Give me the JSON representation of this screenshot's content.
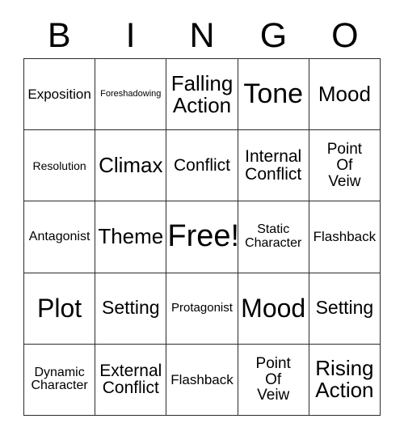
{
  "card": {
    "header_letters": [
      "B",
      "I",
      "N",
      "G",
      "O"
    ],
    "grid": {
      "rows": 5,
      "columns": 5,
      "cells": [
        {
          "text": "Exposition",
          "size": "fs-m"
        },
        {
          "text": "Foreshadowing",
          "size": "fs-xxs"
        },
        {
          "text": "Falling\nAction",
          "size": "fs-xxl"
        },
        {
          "text": "Tone",
          "size": "fs-h3"
        },
        {
          "text": "Mood",
          "size": "fs-xxl"
        },
        {
          "text": "Resolution",
          "size": "fs-xs"
        },
        {
          "text": "Climax",
          "size": "fs-xxl"
        },
        {
          "text": "Conflict",
          "size": "fs-l"
        },
        {
          "text": "Internal\nConflict",
          "size": "fs-l"
        },
        {
          "text": "Point\nOf\nVeiw",
          "size": "fs-ml"
        },
        {
          "text": "Antagonist",
          "size": "fs-sm"
        },
        {
          "text": "Theme",
          "size": "fs-xxl"
        },
        {
          "text": "Free!",
          "size": "fs-free"
        },
        {
          "text": "Static\nCharacter",
          "size": "fs-sm"
        },
        {
          "text": "Flashback",
          "size": "fs-m"
        },
        {
          "text": "Plot",
          "size": "fs-h2"
        },
        {
          "text": "Setting",
          "size": "fs-xl"
        },
        {
          "text": "Protagonist",
          "size": "fs-s"
        },
        {
          "text": "Mood",
          "size": "fs-h2"
        },
        {
          "text": "Setting",
          "size": "fs-xl"
        },
        {
          "text": "Dynamic\nCharacter",
          "size": "fs-sm"
        },
        {
          "text": "External\nConflict",
          "size": "fs-l"
        },
        {
          "text": "Flashback",
          "size": "fs-m"
        },
        {
          "text": "Point\nOf\nVeiw",
          "size": "fs-ml"
        },
        {
          "text": "Rising\nAction",
          "size": "fs-xxl"
        }
      ]
    },
    "colors": {
      "background": "#ffffff",
      "text": "#000000",
      "border": "#2b2b2b"
    }
  }
}
